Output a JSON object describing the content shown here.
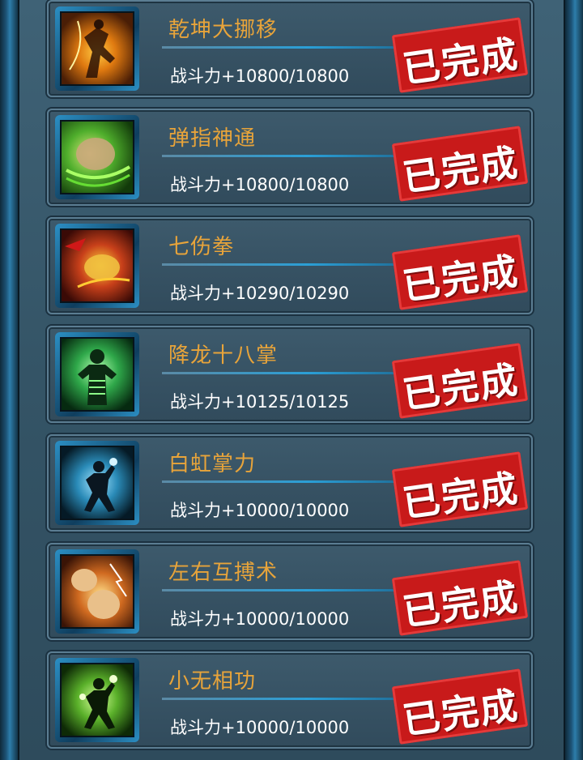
{
  "status_stamp": "已完成",
  "colors": {
    "name": "#e8a43a",
    "stamp": "#c81a1a",
    "frame": "#2b8fc4"
  },
  "skills": [
    {
      "name": "乾坤大挪移",
      "power": "战斗力+10800/10800",
      "icon": "fire-kick-icon"
    },
    {
      "name": "弹指神通",
      "power": "战斗力+10800/10800",
      "icon": "green-fist-icon"
    },
    {
      "name": "七伤拳",
      "power": "战斗力+10290/10290",
      "icon": "red-punch-icon"
    },
    {
      "name": "降龙十八掌",
      "power": "战斗力+10125/10125",
      "icon": "dragon-palm-icon"
    },
    {
      "name": "白虹掌力",
      "power": "战斗力+10000/10000",
      "icon": "blue-martial-artist-icon"
    },
    {
      "name": "左右互搏术",
      "power": "战斗力+10000/10000",
      "icon": "twin-fist-icon"
    },
    {
      "name": "小无相功",
      "power": "战斗力+10000/10000",
      "icon": "green-martial-artist-icon"
    }
  ]
}
